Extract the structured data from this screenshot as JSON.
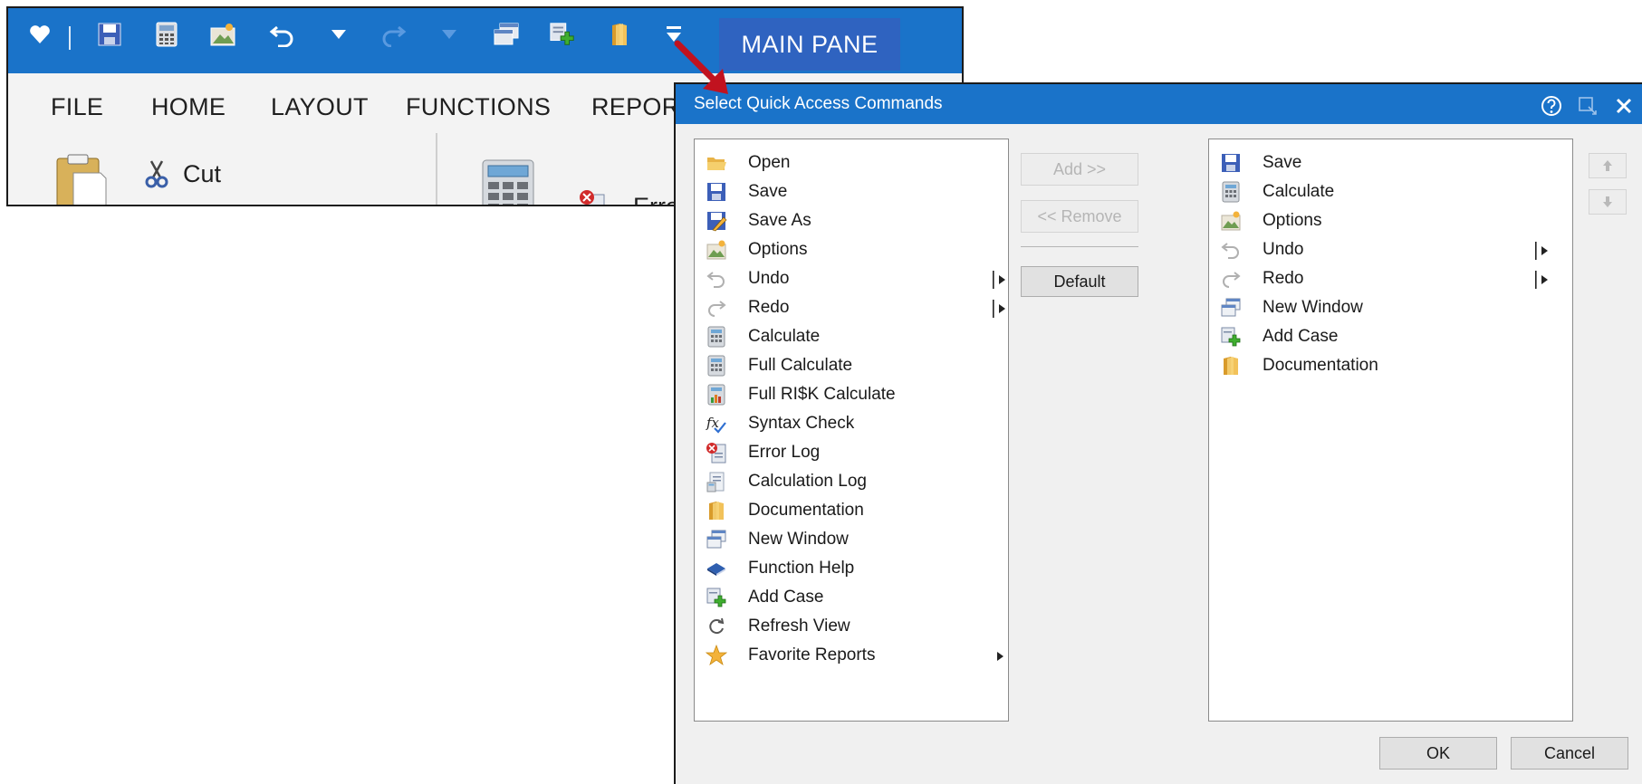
{
  "app": {
    "main_pane_label": "MAIN PANE",
    "tabs": [
      {
        "label": "FILE"
      },
      {
        "label": "HOME",
        "active": true
      },
      {
        "label": "LAYOUT"
      },
      {
        "label": "FUNCTIONS"
      },
      {
        "label": "REPORTS"
      }
    ],
    "ribbon": {
      "cut_label": "Cut",
      "error_label_partial": "Erro"
    }
  },
  "dialog": {
    "title": "Select Quick Access Commands",
    "available_commands": [
      {
        "label": "Open",
        "icon": "folder-open-icon",
        "submenu": false
      },
      {
        "label": "Save",
        "icon": "save-icon",
        "submenu": false
      },
      {
        "label": "Save As",
        "icon": "save-as-icon",
        "submenu": false
      },
      {
        "label": "Options",
        "icon": "options-icon",
        "submenu": false
      },
      {
        "label": "Undo",
        "icon": "undo-icon",
        "submenu": true
      },
      {
        "label": "Redo",
        "icon": "redo-icon",
        "submenu": true
      },
      {
        "label": "Calculate",
        "icon": "calculator-icon",
        "submenu": false
      },
      {
        "label": "Full Calculate",
        "icon": "calculator-icon",
        "submenu": false
      },
      {
        "label": "Full RI$K Calculate",
        "icon": "risk-calculator-icon",
        "submenu": false
      },
      {
        "label": "Syntax Check",
        "icon": "fx-check-icon",
        "submenu": false
      },
      {
        "label": "Error Log",
        "icon": "error-log-icon",
        "submenu": false
      },
      {
        "label": "Calculation Log",
        "icon": "calculation-log-icon",
        "submenu": false
      },
      {
        "label": "Documentation",
        "icon": "documentation-icon",
        "submenu": false
      },
      {
        "label": "New Window",
        "icon": "new-window-icon",
        "submenu": false
      },
      {
        "label": "Function Help",
        "icon": "function-help-icon",
        "submenu": false
      },
      {
        "label": "Add Case",
        "icon": "add-case-icon",
        "submenu": false
      },
      {
        "label": "Refresh View",
        "icon": "refresh-icon",
        "submenu": false
      },
      {
        "label": "Favorite Reports",
        "icon": "star-icon",
        "submenu": true
      }
    ],
    "selected_commands": [
      {
        "label": "Save",
        "icon": "save-icon",
        "submenu": false
      },
      {
        "label": "Calculate",
        "icon": "calculator-icon",
        "submenu": false
      },
      {
        "label": "Options",
        "icon": "options-icon",
        "submenu": false
      },
      {
        "label": "Undo",
        "icon": "undo-icon",
        "submenu": true
      },
      {
        "label": "Redo",
        "icon": "redo-icon",
        "submenu": true
      },
      {
        "label": "New Window",
        "icon": "new-window-icon",
        "submenu": false
      },
      {
        "label": "Add Case",
        "icon": "add-case-icon",
        "submenu": false
      },
      {
        "label": "Documentation",
        "icon": "documentation-icon",
        "submenu": false
      }
    ],
    "buttons": {
      "add": "Add >>",
      "remove": "<< Remove",
      "default": "Default",
      "ok": "OK",
      "cancel": "Cancel"
    }
  },
  "colors": {
    "title_bar": "#1a73c9",
    "main_pane_button": "#2f63c0",
    "arrow": "#c1121f"
  }
}
